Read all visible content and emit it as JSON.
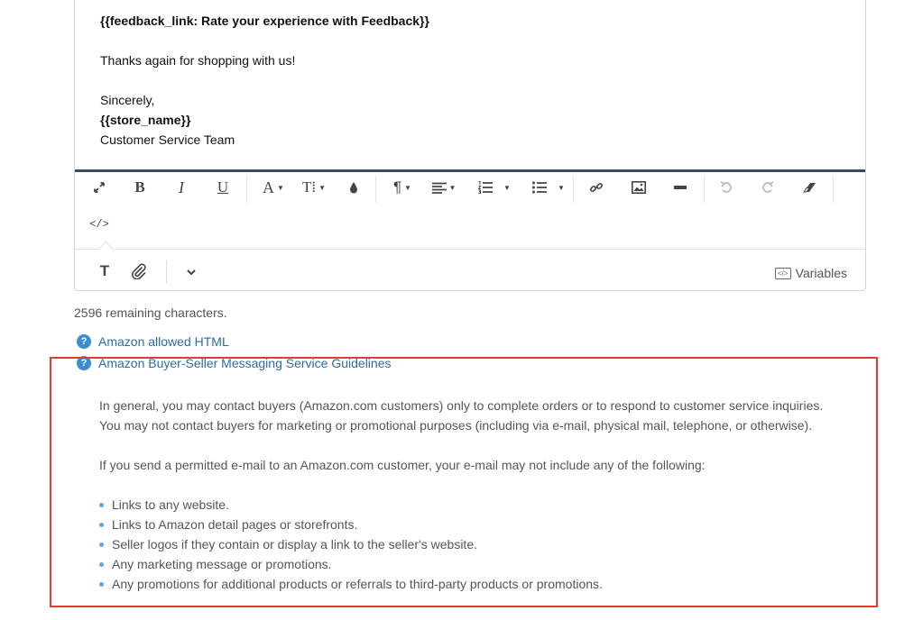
{
  "editor": {
    "lines": {
      "feedback": "{{feedback_link: Rate your experience with Feedback}}",
      "thanks": "Thanks again for shopping with us!",
      "sincerely": "Sincerely,",
      "store": "{{store_name}}",
      "team": "Customer Service Team"
    },
    "toolbar": {
      "bold": "B",
      "italic": "I",
      "underline": "U",
      "font_color": "A",
      "text_size": "T⁞",
      "paragraph": "¶",
      "source": "</>"
    },
    "bottom": {
      "text_mode": "T",
      "variables_label": "Variables"
    }
  },
  "remaining_text": "2596 remaining characters.",
  "links": {
    "allowed_html": "Amazon allowed HTML",
    "guidelines": "Amazon Buyer-Seller Messaging Service Guidelines"
  },
  "guidelines": {
    "para1_line1": "In general, you may contact buyers (Amazon.com customers) only to complete orders or to respond to customer service inquiries.",
    "para1_line2": "You may not contact buyers for marketing or promotional purposes (including via e-mail, physical mail, telephone, or otherwise).",
    "para2": "If you send a permitted e-mail to an Amazon.com customer, your e-mail may not include any of the following:",
    "bullets": [
      "Links to any website.",
      "Links to Amazon detail pages or storefronts.",
      "Seller logos if they contain or display a link to the seller's website.",
      "Any marketing message or promotions.",
      "Any promotions for additional products or referrals to third-party products or promotions."
    ]
  },
  "colors": {
    "link": "#2b6ca8",
    "help_icon": "#3a8ecf",
    "highlight_border": "#e53935",
    "toolbar_divider": "#3d4b5c"
  }
}
